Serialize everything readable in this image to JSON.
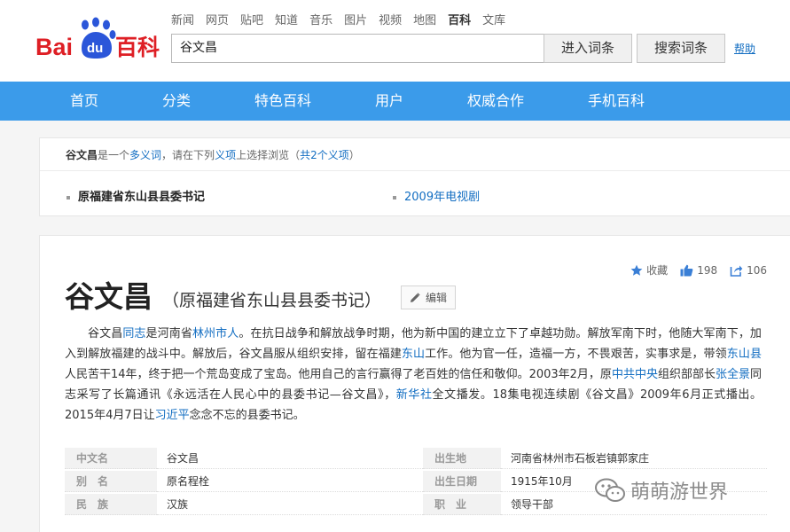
{
  "header": {
    "logo_text_left": "Bai",
    "logo_text_paw": "du",
    "logo_text_right": "百科",
    "topnav": [
      "新闻",
      "网页",
      "贴吧",
      "知道",
      "音乐",
      "图片",
      "视频",
      "地图",
      "百科",
      "文库"
    ],
    "topnav_current_index": 8,
    "search_value": "谷文昌",
    "enter_button": "进入词条",
    "search_button": "搜索词条",
    "help_link": "帮助"
  },
  "mainnav": [
    "首页",
    "分类",
    "特色百科",
    "用户",
    "权威合作",
    "手机百科"
  ],
  "disambiguation": {
    "term": "谷文昌",
    "t1": "是一个",
    "link_polysemy": "多义词",
    "t2": "，请在下列",
    "link_sense": "义项",
    "t3": "上选择浏览（",
    "link_count": "共2个义项",
    "t4": "）",
    "senses": [
      "原福建省东山县县委书记",
      "2009年电视剧"
    ]
  },
  "entry": {
    "tools": {
      "favorite": "收藏",
      "likes": "198",
      "shares": "106"
    },
    "title": "谷文昌",
    "subtitle": "（原福建省东山县县委书记）",
    "edit_button": "编辑",
    "summary": [
      {
        "t": "谷文昌"
      },
      {
        "t": "同志",
        "link": true
      },
      {
        "t": "是河南省"
      },
      {
        "t": "林州市",
        "link": true
      },
      {
        "t": "人",
        "link": true
      },
      {
        "t": "。在抗日战争和解放战争时期，他为新中国的建立立下了卓越功勋。解放军南下时，他随大军南下，加入到解放福建的战斗中。解放后，谷文昌服从组织安排，留在福建"
      },
      {
        "t": "东山",
        "link": true
      },
      {
        "t": "工作。他为官一任，造福一方，不畏艰苦，实事求是，带领"
      },
      {
        "t": "东山县",
        "link": true
      },
      {
        "t": "人民苦干14年，终于把一个荒岛变成了宝岛。他用自己的言行赢得了老百姓的信任和敬仰。2003年2月，原"
      },
      {
        "t": "中共中央",
        "link": true
      },
      {
        "t": "组织部部长"
      },
      {
        "t": "张全景",
        "link": true
      },
      {
        "t": "同志采写了长篇通讯《永远活在人民心中的县委书记—谷文昌》，"
      },
      {
        "t": "新华社",
        "link": true
      },
      {
        "t": "全文播发。18集电视连续剧《谷文昌》2009年6月正式播出。2015年4月7日让"
      },
      {
        "t": "习近平",
        "link": true
      },
      {
        "t": "念念不忘的县委书记。"
      }
    ],
    "info": [
      {
        "label": "中文名",
        "value": "谷文昌",
        "label2": "出生地",
        "value2": "河南省林州市石板岩镇郭家庄"
      },
      {
        "label": "别　名",
        "value": "原名程栓",
        "label2": "出生日期",
        "value2": "1915年10月"
      },
      {
        "label": "民　族",
        "value": "汉族",
        "label2": "职　业",
        "value2": "领导干部"
      }
    ]
  },
  "watermark": "萌萌游世界",
  "colors": {
    "brand_red": "#de1f25",
    "brand_blue": "#2b56d9",
    "nav_blue": "#3b9bea",
    "link": "#136ec2"
  }
}
